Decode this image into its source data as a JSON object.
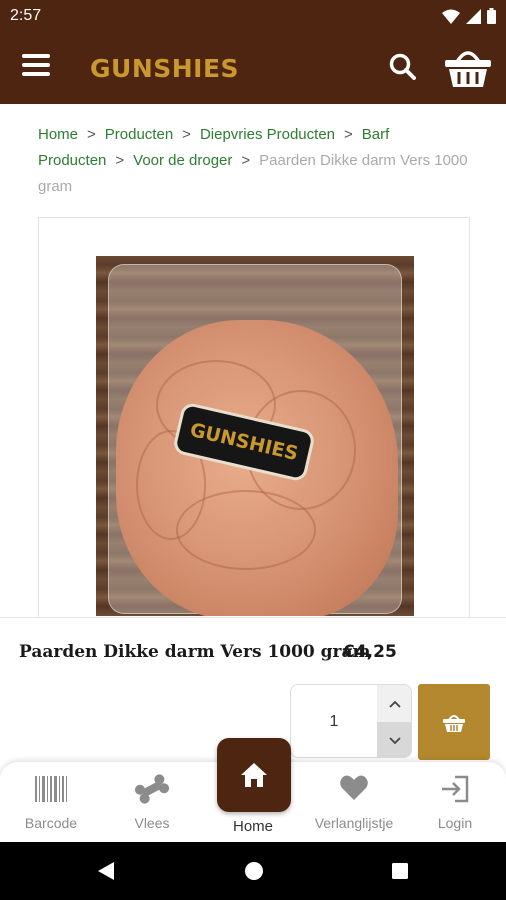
{
  "status": {
    "time": "2:57"
  },
  "header": {
    "logo_text": "GUNSHIES",
    "menu_icon": "hamburger-menu-icon",
    "search_icon": "search-icon",
    "cart_icon": "shopping-basket-icon"
  },
  "breadcrumb": {
    "items": [
      "Home",
      "Producten",
      "Diepvries Producten",
      "Barf Producten",
      "Voor de droger"
    ],
    "current": "Paarden Dikke darm Vers 1000 gram",
    "separator": ">"
  },
  "product": {
    "title": "Paarden Dikke darm Vers 1000 gram",
    "price": "€4,25",
    "quantity": "1",
    "sticker_text": "GUNSHIES"
  },
  "bottom_nav": {
    "items": [
      {
        "label": "Barcode",
        "icon": "barcode-icon"
      },
      {
        "label": "Vlees",
        "icon": "bone-icon"
      },
      {
        "label": "Home",
        "icon": "home-icon"
      },
      {
        "label": "Verlanglijstje",
        "icon": "heart-icon"
      },
      {
        "label": "Login",
        "icon": "login-icon"
      }
    ]
  },
  "colors": {
    "brand_brown": "#4e2510",
    "brand_gold": "#b3882e",
    "link_green": "#2e7d32"
  }
}
